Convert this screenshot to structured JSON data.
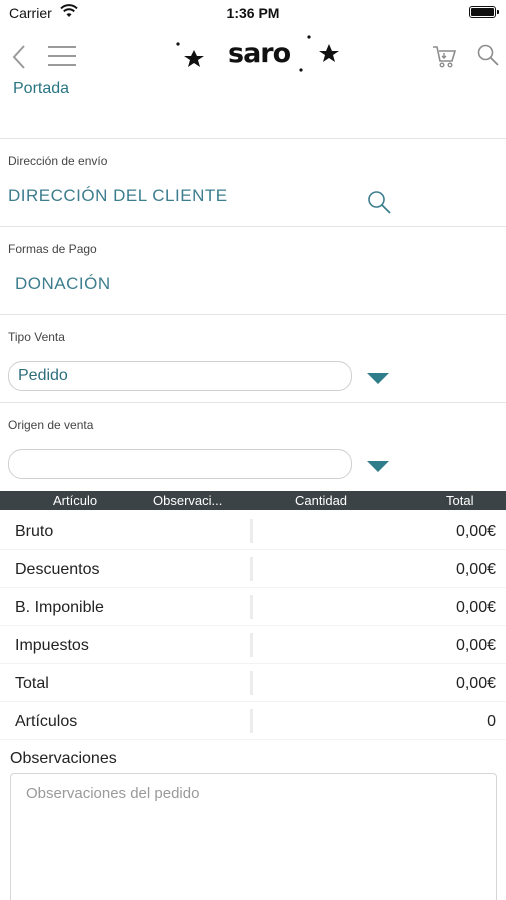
{
  "status_bar": {
    "carrier": "Carrier",
    "time": "1:36 PM",
    "battery_level": 0.9
  },
  "nav": {
    "logo_text": "saro",
    "icons": [
      "back-arrow-icon",
      "hamburger-menu-icon",
      "cart-icon",
      "search-icon"
    ]
  },
  "breadcrumb": "Portada",
  "form": {
    "shipping": {
      "label": "Dirección de envío",
      "value": "DIRECCIÓN DEL CLIENTE"
    },
    "payment": {
      "label": "Formas de Pago",
      "value": "DONACIÓN"
    },
    "sale_type": {
      "label": "Tipo Venta",
      "value": "Pedido"
    },
    "sale_origin": {
      "label": "Origen de venta",
      "value": ""
    }
  },
  "table_header": {
    "article": "Artículo",
    "notes": "Observaci...",
    "quantity": "Cantidad",
    "total": "Total"
  },
  "summary": [
    {
      "label": "Bruto",
      "value": "0,00€"
    },
    {
      "label": "Descuentos",
      "value": "0,00€"
    },
    {
      "label": "B. Imponible",
      "value": "0,00€"
    },
    {
      "label": "Impuestos",
      "value": "0,00€"
    },
    {
      "label": "Total",
      "value": "0,00€"
    },
    {
      "label": "Artículos",
      "value": "0"
    }
  ],
  "observations": {
    "label": "Observaciones",
    "placeholder": "Observaciones del pedido"
  },
  "colors": {
    "accent": "#3d7d8e",
    "header_bg": "#3c4346",
    "caret": "#2f7c8a"
  }
}
